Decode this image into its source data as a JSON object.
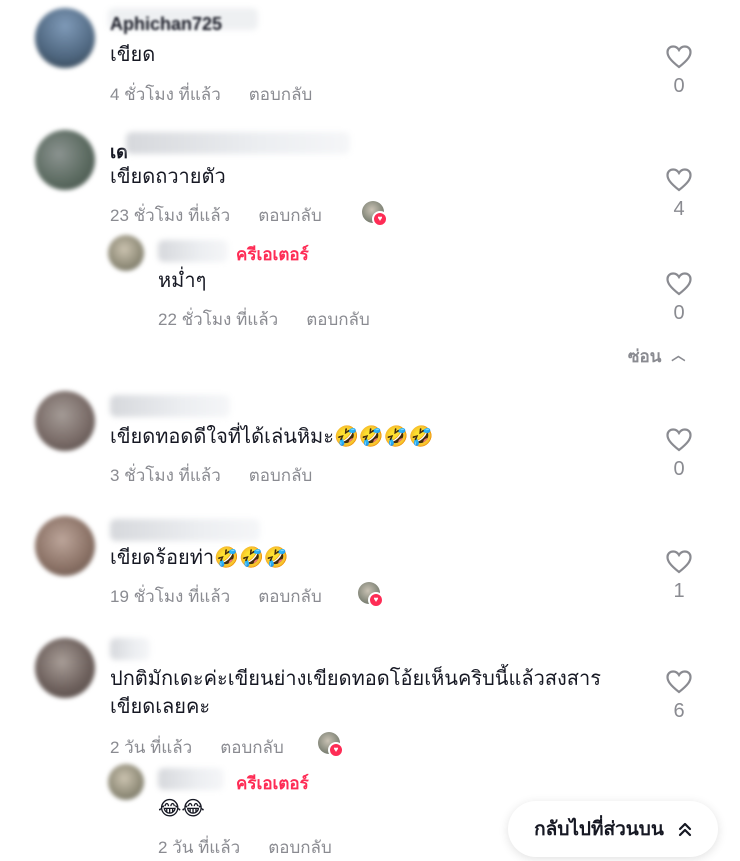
{
  "comments": [
    {
      "name": "Aphichan725",
      "text": "เขียด",
      "time": "4 ชั่วโมง ที่แล้ว",
      "reply": "ตอบกลับ",
      "likes": "0"
    },
    {
      "name": "เด",
      "text": "เขียดถวายตัว",
      "time": "23 ชั่วโมง ที่แล้ว",
      "reply": "ตอบกลับ",
      "likes": "4",
      "creator_liked": true,
      "replies": [
        {
          "creator_label": "ครีเอเตอร์",
          "text": "หม่ำๆ",
          "time": "22 ชั่วโมง ที่แล้ว",
          "reply": "ตอบกลับ",
          "likes": "0"
        }
      ],
      "hide_label": "ซ่อน"
    },
    {
      "text": "เขียดทอดดีใจที่ได้เล่นหิมะ🤣🤣🤣🤣",
      "time": "3 ชั่วโมง ที่แล้ว",
      "reply": "ตอบกลับ",
      "likes": "0"
    },
    {
      "text": "เขียดร้อยท่า🤣🤣🤣",
      "time": "19 ชั่วโมง ที่แล้ว",
      "reply": "ตอบกลับ",
      "likes": "1",
      "creator_liked": true
    },
    {
      "text_line1": "ปกติมักเดะค่ะเขียนย่างเขียดทอดโอ้ยเห็นคริบนี้แล้วสงสาร",
      "text_line2": "เขียดเลยคะ",
      "time": "2 วัน ที่แล้ว",
      "reply": "ตอบกลับ",
      "likes": "6",
      "creator_liked": true,
      "replies": [
        {
          "creator_label": "ครีเอเตอร์",
          "text": "😂😂",
          "time": "2 วัน ที่แล้ว",
          "reply": "ตอบกลับ"
        }
      ]
    }
  ],
  "back_to_top": "กลับไปที่ส่วนบน",
  "colors": {
    "creator": "#fe2c55",
    "meta": "#8a8b91",
    "text": "#161823"
  }
}
